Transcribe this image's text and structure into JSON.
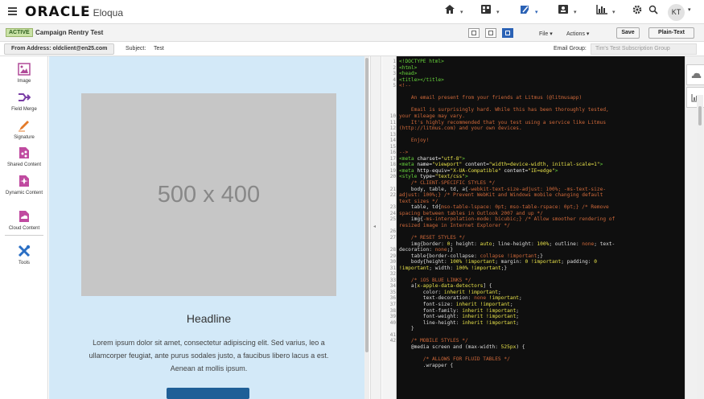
{
  "header": {
    "brand": "ORACLE",
    "brand_sub": "Eloqua",
    "avatar_initials": "KT",
    "nav_icons": [
      "home-icon",
      "assets-icon",
      "campaigns-icon",
      "contacts-icon",
      "insight-icon",
      "settings-icon",
      "search-icon"
    ]
  },
  "toolbar": {
    "status_badge": "ACTIVE",
    "campaign_name": "Campaign Rentry Test",
    "file_label": "File",
    "actions_label": "Actions",
    "save_label": "Save",
    "plain_text_label": "Plain-Text",
    "accent_color": "#2b62b5"
  },
  "subject_bar": {
    "from_address": "From Address: oldclient@en25.com",
    "subject_label": "Subject:",
    "subject_value": "Test",
    "email_group_label": "Email Group:",
    "email_group_value": "Tim's Test Subscription Group"
  },
  "sidebar": {
    "items": [
      {
        "label": "Image",
        "icon": "image-icon"
      },
      {
        "label": "Field Merge",
        "icon": "field-merge-icon"
      },
      {
        "label": "Signature",
        "icon": "signature-icon"
      },
      {
        "label": "Shared Content",
        "icon": "shared-content-icon"
      },
      {
        "label": "Dynamic Content",
        "icon": "dynamic-content-icon"
      },
      {
        "label": "Cloud Content",
        "icon": "cloud-content-icon"
      },
      {
        "label": "Tools",
        "icon": "tools-icon"
      }
    ]
  },
  "email_preview": {
    "placeholder_text": "500 x 400",
    "headline": "Headline",
    "body": "Lorem ipsum dolor sit amet, consectetur adipiscing elit. Sed varius, leo a ullamcorper feugiat, ante purus sodales justo, a faucibus libero lacus a est. Aenean at mollis ipsum."
  },
  "code_editor": {
    "line_numbers": [
      "1",
      "2",
      "3",
      "4",
      "5",
      "",
      "",
      "",
      "",
      "10",
      "11",
      "12",
      "13",
      "14",
      "15",
      "16",
      "17",
      "18",
      "19",
      "20",
      "",
      "21",
      "22",
      "",
      "23",
      "24",
      "25",
      "",
      "26",
      "27",
      "",
      "28",
      "29",
      "30",
      "31",
      "32",
      "33",
      "34",
      "35",
      "36",
      "37",
      "38",
      "39",
      "40",
      "",
      "41",
      "42"
    ],
    "lines": [
      [
        {
          "c": "t",
          "s": "<!DOCTYPE html>"
        }
      ],
      [
        {
          "c": "t",
          "s": "<html>"
        }
      ],
      [
        {
          "c": "t",
          "s": "<head>"
        }
      ],
      [
        {
          "c": "t",
          "s": "<title></title>"
        }
      ],
      [
        {
          "c": "c",
          "s": "<!--"
        }
      ],
      [
        {
          "c": "c",
          "s": ""
        }
      ],
      [
        {
          "c": "c",
          "s": "    An email present from your friends at Litmus (@litmusapp)"
        }
      ],
      [
        {
          "c": "c",
          "s": ""
        }
      ],
      [
        {
          "c": "c",
          "s": "    Email is surprisingly hard. While this has been thoroughly tested,"
        }
      ],
      [
        {
          "c": "c",
          "s": "your mileage may vary."
        }
      ],
      [
        {
          "c": "c",
          "s": "    It's highly recommended that you test using a service like Litmus"
        }
      ],
      [
        {
          "c": "c",
          "s": "(http://litmus.com) and your own devices."
        }
      ],
      [
        {
          "c": "c",
          "s": ""
        }
      ],
      [
        {
          "c": "c",
          "s": "    Enjoy!"
        }
      ],
      [
        {
          "c": "c",
          "s": ""
        }
      ],
      [
        {
          "c": "c",
          "s": "-->"
        }
      ],
      [
        {
          "c": "t",
          "s": "<meta "
        },
        {
          "c": "k",
          "s": "charset="
        },
        {
          "c": "s",
          "s": "\"utf-8\""
        },
        {
          "c": "t",
          "s": ">"
        }
      ],
      [
        {
          "c": "t",
          "s": "<meta "
        },
        {
          "c": "k",
          "s": "name="
        },
        {
          "c": "s",
          "s": "\"viewport\""
        },
        {
          "c": "k",
          "s": " content="
        },
        {
          "c": "s",
          "s": "\"width=device-width, initial-scale=1\""
        },
        {
          "c": "t",
          "s": ">"
        }
      ],
      [
        {
          "c": "t",
          "s": "<meta "
        },
        {
          "c": "k",
          "s": "http-equiv="
        },
        {
          "c": "s",
          "s": "\"X-UA-Compatible\""
        },
        {
          "c": "k",
          "s": " content="
        },
        {
          "c": "s",
          "s": "\"IE=edge\""
        },
        {
          "c": "t",
          "s": ">"
        }
      ],
      [
        {
          "c": "t",
          "s": "<style "
        },
        {
          "c": "k",
          "s": "type="
        },
        {
          "c": "s",
          "s": "\"text/css\""
        },
        {
          "c": "t",
          "s": ">"
        }
      ],
      [
        {
          "c": "c",
          "s": "    /* CLIENT-SPECIFIC STYLES */"
        }
      ],
      [
        {
          "c": "v",
          "s": "    body, table, td, a{"
        },
        {
          "c": "c",
          "s": "-webkit-text-size-adjust: 100%; -ms-text-size-"
        }
      ],
      [
        {
          "c": "c",
          "s": "adjust: 100%;} /* Prevent WebKit and Windows mobile changing default"
        }
      ],
      [
        {
          "c": "c",
          "s": "text sizes */"
        }
      ],
      [
        {
          "c": "v",
          "s": "    table, td{"
        },
        {
          "c": "c",
          "s": "mso-table-lspace: 0pt; mso-table-rspace: 0pt;} /* Remove"
        }
      ],
      [
        {
          "c": "c",
          "s": "spacing between tables in Outlook 2007 and up */"
        }
      ],
      [
        {
          "c": "v",
          "s": "    img{"
        },
        {
          "c": "c",
          "s": "-ms-interpolation-mode: bicubic;} /* Allow smoother rendering of"
        }
      ],
      [
        {
          "c": "c",
          "s": "resized image in Internet Explorer */"
        }
      ],
      [
        {
          "c": "v",
          "s": ""
        }
      ],
      [
        {
          "c": "c",
          "s": "    /* RESET STYLES */"
        }
      ],
      [
        {
          "c": "v",
          "s": "    img{border: "
        },
        {
          "c": "s",
          "s": "0"
        },
        {
          "c": "v",
          "s": "; height: "
        },
        {
          "c": "s",
          "s": "auto"
        },
        {
          "c": "v",
          "s": "; line-height: "
        },
        {
          "c": "s",
          "s": "100%"
        },
        {
          "c": "v",
          "s": "; outline: "
        },
        {
          "c": "c",
          "s": "none"
        },
        {
          "c": "v",
          "s": "; text-"
        }
      ],
      [
        {
          "c": "v",
          "s": "decoration: "
        },
        {
          "c": "c",
          "s": "none"
        },
        {
          "c": "v",
          "s": ";}"
        }
      ],
      [
        {
          "c": "v",
          "s": "    table{border-collapse: "
        },
        {
          "c": "c",
          "s": "collapse !important"
        },
        {
          "c": "v",
          "s": ";}"
        }
      ],
      [
        {
          "c": "v",
          "s": "    body{height: "
        },
        {
          "c": "s",
          "s": "100% !important"
        },
        {
          "c": "v",
          "s": "; margin: "
        },
        {
          "c": "s",
          "s": "0 !important"
        },
        {
          "c": "v",
          "s": "; padding: "
        },
        {
          "c": "s",
          "s": "0"
        }
      ],
      [
        {
          "c": "s",
          "s": "!important"
        },
        {
          "c": "v",
          "s": "; width: "
        },
        {
          "c": "s",
          "s": "100% !important"
        },
        {
          "c": "v",
          "s": ";}"
        }
      ],
      [
        {
          "c": "v",
          "s": ""
        }
      ],
      [
        {
          "c": "c",
          "s": "    /* iOS BLUE LINKS */"
        }
      ],
      [
        {
          "c": "v",
          "s": "    a["
        },
        {
          "c": "s",
          "s": "x-apple-data-detectors"
        },
        {
          "c": "v",
          "s": "] {"
        }
      ],
      [
        {
          "c": "v",
          "s": "        color: "
        },
        {
          "c": "s",
          "s": "inherit !important"
        },
        {
          "c": "v",
          "s": ";"
        }
      ],
      [
        {
          "c": "v",
          "s": "        text-decoration: "
        },
        {
          "c": "c",
          "s": "none"
        },
        {
          "c": "s",
          "s": " !important"
        },
        {
          "c": "v",
          "s": ";"
        }
      ],
      [
        {
          "c": "v",
          "s": "        font-size: "
        },
        {
          "c": "s",
          "s": "inherit !important"
        },
        {
          "c": "v",
          "s": ";"
        }
      ],
      [
        {
          "c": "v",
          "s": "        font-family: "
        },
        {
          "c": "s",
          "s": "inherit !important"
        },
        {
          "c": "v",
          "s": ";"
        }
      ],
      [
        {
          "c": "v",
          "s": "        font-weight: "
        },
        {
          "c": "s",
          "s": "inherit !important"
        },
        {
          "c": "v",
          "s": ";"
        }
      ],
      [
        {
          "c": "v",
          "s": "        line-height: "
        },
        {
          "c": "s",
          "s": "inherit !important"
        },
        {
          "c": "v",
          "s": ";"
        }
      ],
      [
        {
          "c": "v",
          "s": "    }"
        }
      ],
      [
        {
          "c": "v",
          "s": ""
        }
      ],
      [
        {
          "c": "c",
          "s": "    /* MOBILE STYLES */"
        }
      ],
      [
        {
          "c": "v",
          "s": "    @media screen and (max-width: "
        },
        {
          "c": "s",
          "s": "525px"
        },
        {
          "c": "v",
          "s": ") {"
        }
      ],
      [
        {
          "c": "v",
          "s": ""
        }
      ],
      [
        {
          "c": "c",
          "s": "        /* ALLOWS FOR FLUID TABLES */"
        }
      ],
      [
        {
          "c": "v",
          "s": "        .wrapper {"
        }
      ]
    ]
  }
}
